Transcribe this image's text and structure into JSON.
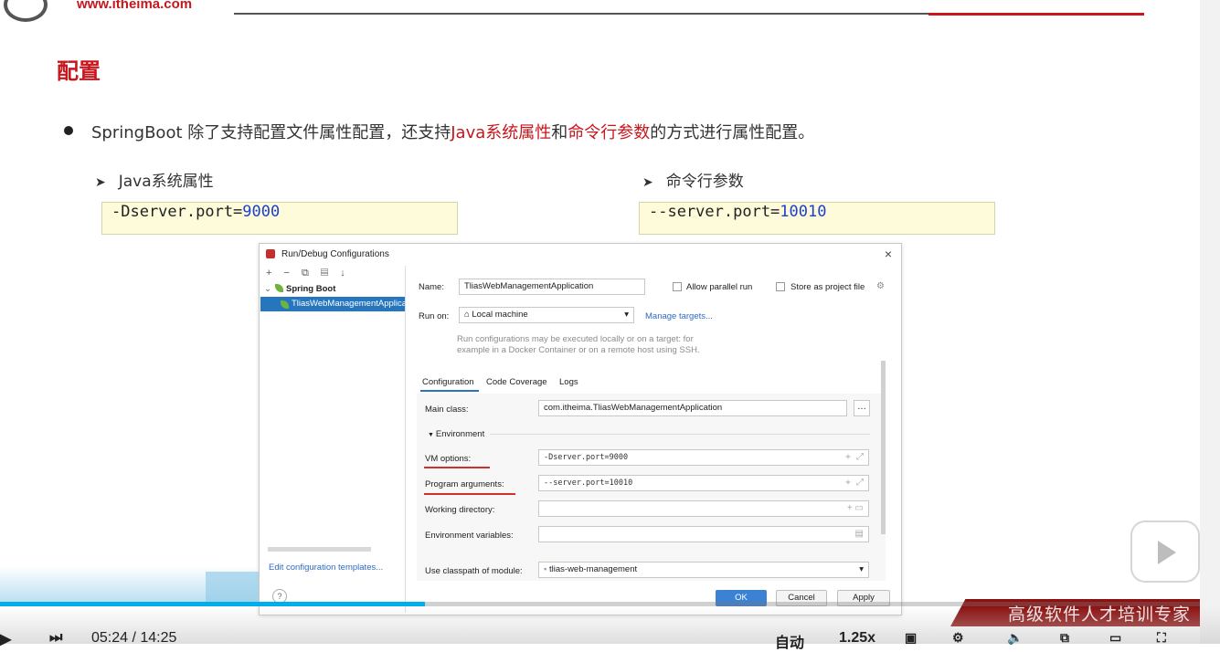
{
  "slide": {
    "site_url": "www.itheima.com",
    "section_title": "配置",
    "bullet": {
      "part1": "SpringBoot 除了支持配置文件属性配置，还支持",
      "highlight1": "Java系统属性",
      "part2": "和",
      "highlight2": "命令行参数",
      "part3": "的方式进行属性配置。"
    },
    "left": {
      "heading": "Java系统属性",
      "code_prefix": "-Dserver.port=",
      "code_value": "9000"
    },
    "right": {
      "heading": "命令行参数",
      "code_prefix": "--server.port=",
      "code_value": "10010"
    },
    "arrow_glyph": "➤"
  },
  "dialog": {
    "title": "Run/Debug Configurations",
    "close": "×",
    "toolbar": "+ − ⧉ ▤ ↓",
    "tree": {
      "group": "Spring Boot",
      "selected": "TliasWebManagementApplication"
    },
    "edit_templates": "Edit configuration templates...",
    "help": "?",
    "name_label": "Name:",
    "name_value": "TliasWebManagementApplication",
    "allow_parallel": "Allow parallel run",
    "store_as_project": "Store as project file",
    "run_on_label": "Run on:",
    "run_on_value": "Local machine",
    "manage_targets": "Manage targets...",
    "hint_line1": "Run configurations may be executed locally or on a target: for",
    "hint_line2": "example in a Docker Container or on a remote host using SSH.",
    "tabs": [
      "Configuration",
      "Code Coverage",
      "Logs"
    ],
    "main_class_label": "Main class:",
    "main_class_value": "com.itheima.TliasWebManagementApplication",
    "environment": "Environment",
    "vm_options_label": "VM options:",
    "vm_options_value": "-Dserver.port=9000",
    "program_args_label": "Program arguments:",
    "program_args_value": "--server.port=10010",
    "working_dir_label": "Working directory:",
    "env_vars_label": "Environment variables:",
    "classpath_label": "Use classpath of module:",
    "classpath_value": "tlias-web-management",
    "ok": "OK",
    "cancel": "Cancel",
    "apply": "Apply"
  },
  "player": {
    "time": "05:24 / 14:25",
    "speed_auto": "自动",
    "speed": "1.25x",
    "banner": "高级软件人才培训专家",
    "progress": 0.3483
  },
  "colors": {
    "brand_red": "#c8161d",
    "code_bg": "#fdfbd9",
    "selection_blue": "#2675bf",
    "progress_blue": "#00aeec"
  }
}
